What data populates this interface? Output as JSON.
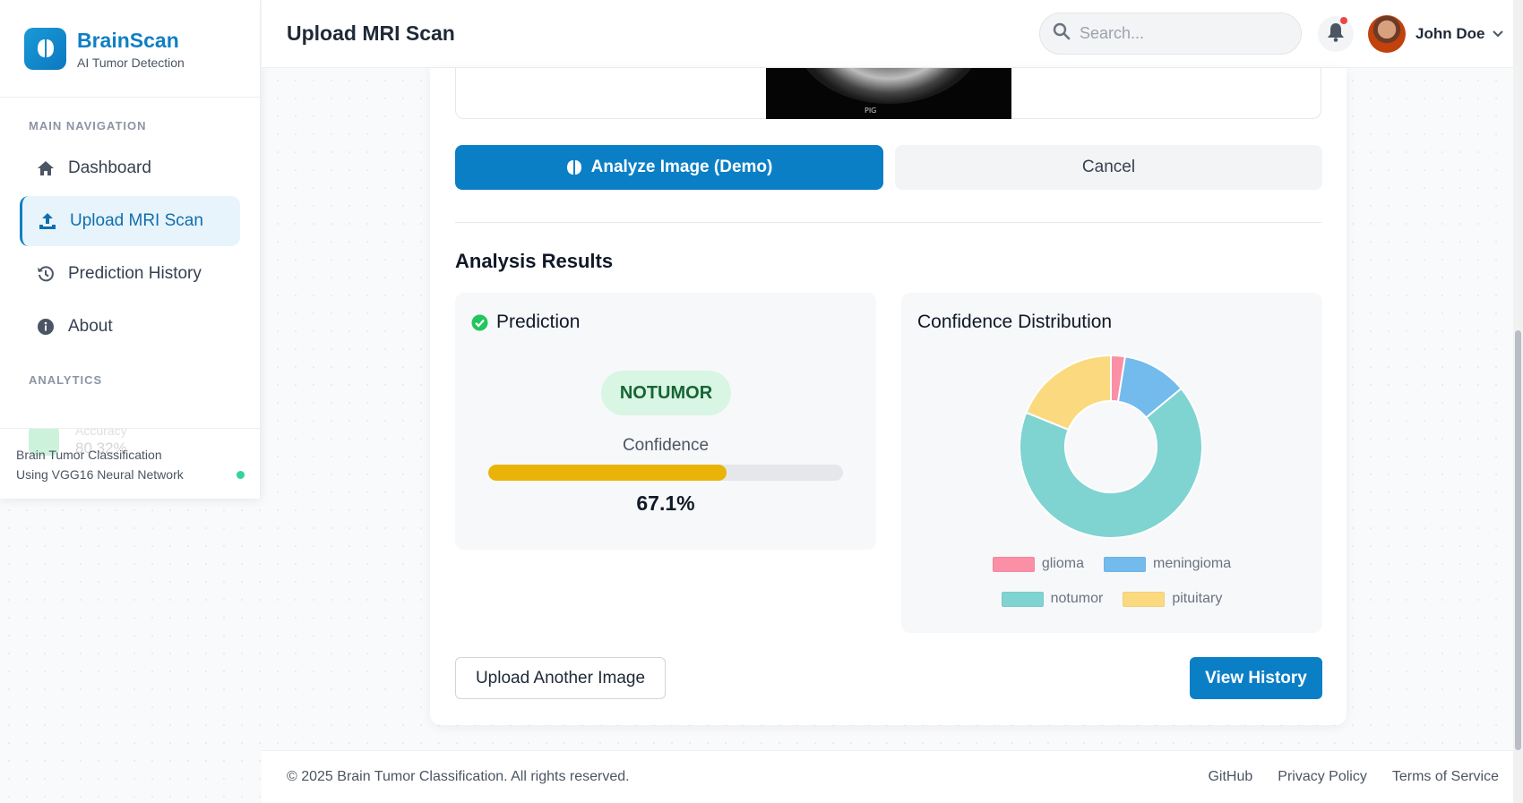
{
  "brand": {
    "name": "BrainScan",
    "tagline": "AI Tumor Detection"
  },
  "sidebar": {
    "section_main": "MAIN NAVIGATION",
    "items": [
      {
        "label": "Dashboard",
        "icon": "home-icon"
      },
      {
        "label": "Upload MRI Scan",
        "icon": "upload-icon",
        "active": true
      },
      {
        "label": "Prediction History",
        "icon": "history-icon"
      },
      {
        "label": "About",
        "icon": "info-icon"
      }
    ],
    "section_analytics": "ANALYTICS",
    "analytics_card": {
      "label": "Accuracy",
      "value": "80.32%"
    },
    "footer": {
      "title": "Brain Tumor Classification",
      "subtitle": "Using VGG16 Neural Network"
    }
  },
  "header": {
    "title": "Upload MRI Scan",
    "search_placeholder": "Search...",
    "user_name": "John Doe"
  },
  "main": {
    "image_mark": "PIG",
    "analyze_button": "Analyze Image (Demo)",
    "cancel_button": "Cancel",
    "results_title": "Analysis Results",
    "prediction": {
      "heading": "Prediction",
      "label": "NOTUMOR",
      "confidence_label": "Confidence",
      "confidence_value": "67.1%",
      "confidence_fraction": 0.671
    },
    "distribution": {
      "heading": "Confidence Distribution"
    },
    "upload_another_button": "Upload Another Image",
    "view_history_button": "View History"
  },
  "chart_data": {
    "type": "pie",
    "donut": true,
    "categories": [
      "glioma",
      "meningioma",
      "notumor",
      "pituitary"
    ],
    "values": [
      2.5,
      11.5,
      67.1,
      18.9
    ],
    "colors": [
      "#fb8fa5",
      "#72bbec",
      "#7fd4d1",
      "#fbd97f"
    ],
    "legend_position": "bottom"
  },
  "footer": {
    "copyright": "© 2025 Brain Tumor Classification. All rights reserved.",
    "links": [
      "GitHub",
      "Privacy Policy",
      "Terms of Service"
    ]
  },
  "colors": {
    "primary": "#0b7fc6",
    "success_badge_bg": "#d9f5e3",
    "confidence_bar": "#eab308"
  }
}
